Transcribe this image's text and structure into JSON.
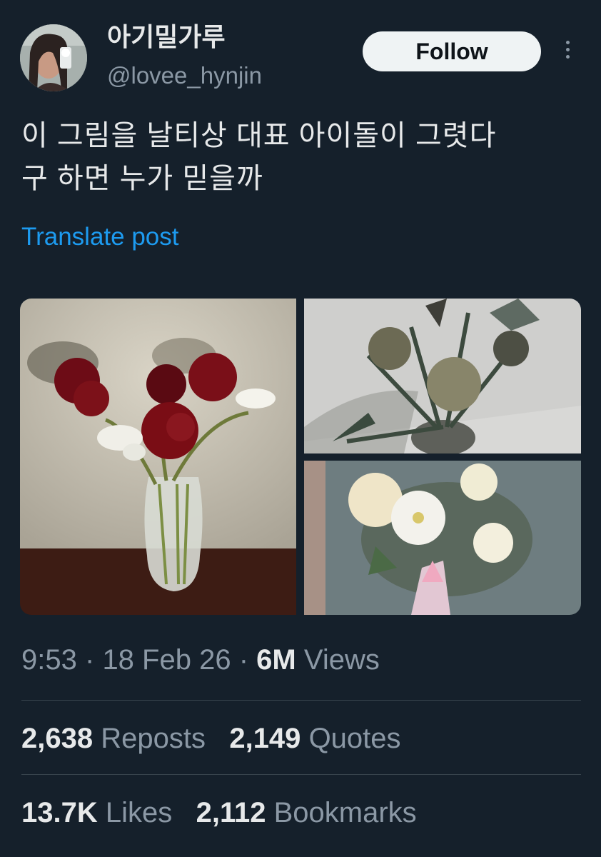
{
  "author": {
    "display_name": "아기밀가루",
    "handle": "@lovee_hynjin"
  },
  "follow_label": "Follow",
  "tweet": {
    "line1": "이 그림을 날티상 대표 아이돌이 그렷다",
    "line2": "구 하면 누가 믿을까"
  },
  "translate_label": "Translate post",
  "meta": {
    "time": "9:53",
    "date": "18 Feb 26",
    "views_count": "6M",
    "views_label": "Views",
    "separator": "·"
  },
  "stats": {
    "reposts_count": "2,638",
    "reposts_label": "Reposts",
    "quotes_count": "2,149",
    "quotes_label": "Quotes",
    "likes_count": "13.7K",
    "likes_label": "Likes",
    "bookmarks_count": "2,112",
    "bookmarks_label": "Bookmarks"
  },
  "colors": {
    "background": "#15202b",
    "text_primary": "#e7e9ea",
    "text_secondary": "#8b98a5",
    "accent": "#1d9bf0",
    "divider": "#38444d"
  },
  "icons": [
    "more-vertical-icon"
  ]
}
